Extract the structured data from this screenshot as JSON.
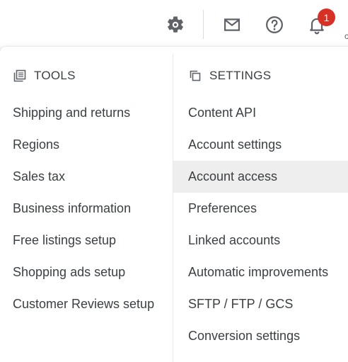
{
  "header": {
    "icons": {
      "settings": "gear-icon",
      "mail": "mail-icon",
      "help": "help-icon",
      "notifications": "bell-icon"
    },
    "notification_count": "1",
    "edge_glyph": "c",
    "colors": {
      "icon": "#5f6368",
      "badge": "#d93025",
      "active_row": "#eeeeee",
      "text": "#3c4043"
    }
  },
  "tools": {
    "title": "TOOLS",
    "icon": "tools-grid-icon",
    "items": [
      {
        "label": "Shipping and returns"
      },
      {
        "label": "Regions"
      },
      {
        "label": "Sales tax"
      },
      {
        "label": "Business information"
      },
      {
        "label": "Free listings setup"
      },
      {
        "label": "Shopping ads setup"
      },
      {
        "label": "Customer Reviews setup"
      }
    ]
  },
  "settings": {
    "title": "SETTINGS",
    "icon": "settings-copy-icon",
    "items": [
      {
        "label": "Content API"
      },
      {
        "label": "Account settings"
      },
      {
        "label": "Account access",
        "active": true
      },
      {
        "label": "Preferences"
      },
      {
        "label": "Linked accounts"
      },
      {
        "label": "Automatic improvements"
      },
      {
        "label": "SFTP / FTP / GCS"
      },
      {
        "label": "Conversion settings"
      }
    ]
  }
}
